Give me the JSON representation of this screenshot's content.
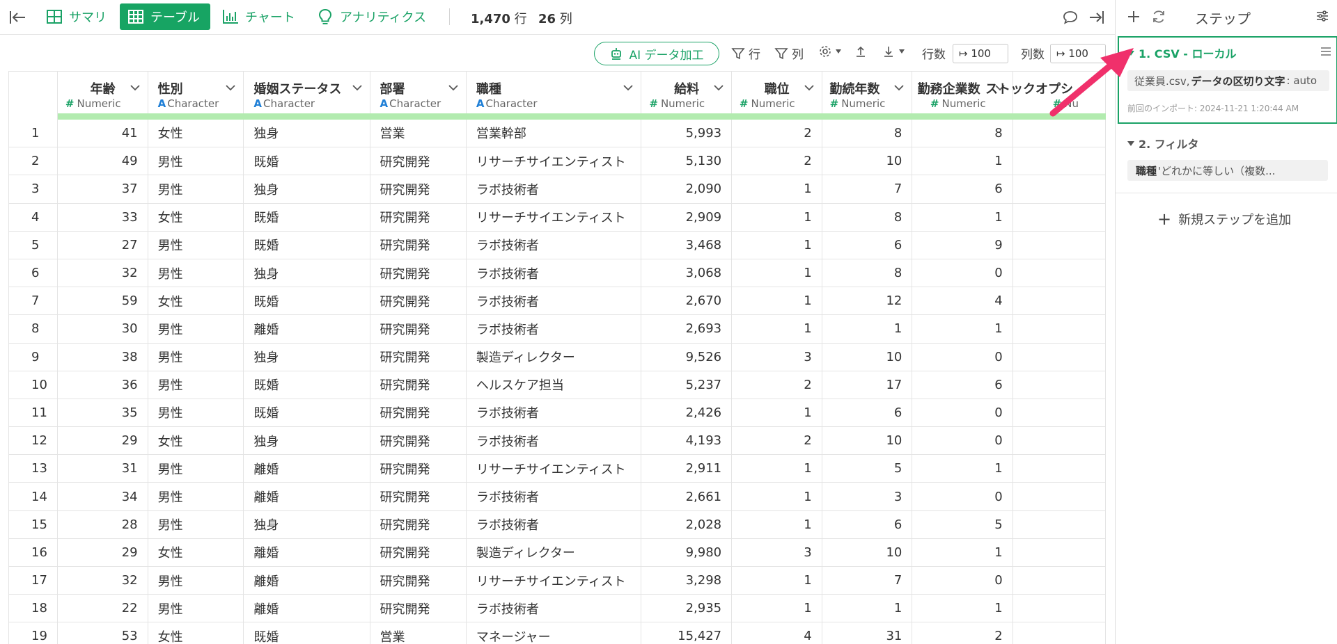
{
  "topbar": {
    "views": [
      {
        "label": "サマリ",
        "icon": "summary-grid-icon"
      },
      {
        "label": "テーブル",
        "icon": "table-icon"
      },
      {
        "label": "チャート",
        "icon": "bar-chart-icon"
      },
      {
        "label": "アナリティクス",
        "icon": "lightbulb-icon"
      }
    ],
    "rows_count": "1,470",
    "rows_unit": "行",
    "cols_count": "26",
    "cols_unit": "列"
  },
  "toolbar": {
    "ai_label": "AI データ加工",
    "filter_rows": "行",
    "filter_cols": "列",
    "rows_label": "行数",
    "rows_value": "↦ 100",
    "cols_label": "列数",
    "cols_value": "↦ 100"
  },
  "columns": [
    {
      "name": "年齢",
      "type": "Numeric",
      "kind": "num"
    },
    {
      "name": "性別",
      "type": "Character",
      "kind": "chr"
    },
    {
      "name": "婚姻ステータス",
      "type": "Character",
      "kind": "chr"
    },
    {
      "name": "部署",
      "type": "Character",
      "kind": "chr"
    },
    {
      "name": "職種",
      "type": "Character",
      "kind": "chr"
    },
    {
      "name": "給料",
      "type": "Numeric",
      "kind": "num"
    },
    {
      "name": "職位",
      "type": "Numeric",
      "kind": "num"
    },
    {
      "name": "勤続年数",
      "type": "Numeric",
      "kind": "num"
    },
    {
      "name": "勤務企業数",
      "type": "Numeric",
      "kind": "num"
    },
    {
      "name": "ストックオプシ",
      "type": "Nu",
      "kind": "num"
    }
  ],
  "rows": [
    [
      "1",
      "41",
      "女性",
      "独身",
      "営業",
      "営業幹部",
      "5,993",
      "2",
      "8",
      "8",
      ""
    ],
    [
      "2",
      "49",
      "男性",
      "既婚",
      "研究開発",
      "リサーチサイエンティスト",
      "5,130",
      "2",
      "10",
      "1",
      ""
    ],
    [
      "3",
      "37",
      "男性",
      "独身",
      "研究開発",
      "ラボ技術者",
      "2,090",
      "1",
      "7",
      "6",
      ""
    ],
    [
      "4",
      "33",
      "女性",
      "既婚",
      "研究開発",
      "リサーチサイエンティスト",
      "2,909",
      "1",
      "8",
      "1",
      ""
    ],
    [
      "5",
      "27",
      "男性",
      "既婚",
      "研究開発",
      "ラボ技術者",
      "3,468",
      "1",
      "6",
      "9",
      ""
    ],
    [
      "6",
      "32",
      "男性",
      "独身",
      "研究開発",
      "ラボ技術者",
      "3,068",
      "1",
      "8",
      "0",
      ""
    ],
    [
      "7",
      "59",
      "女性",
      "既婚",
      "研究開発",
      "ラボ技術者",
      "2,670",
      "1",
      "12",
      "4",
      ""
    ],
    [
      "8",
      "30",
      "男性",
      "離婚",
      "研究開発",
      "ラボ技術者",
      "2,693",
      "1",
      "1",
      "1",
      ""
    ],
    [
      "9",
      "38",
      "男性",
      "独身",
      "研究開発",
      "製造ディレクター",
      "9,526",
      "3",
      "10",
      "0",
      ""
    ],
    [
      "10",
      "36",
      "男性",
      "既婚",
      "研究開発",
      "ヘルスケア担当",
      "5,237",
      "2",
      "17",
      "6",
      ""
    ],
    [
      "11",
      "35",
      "男性",
      "既婚",
      "研究開発",
      "ラボ技術者",
      "2,426",
      "1",
      "6",
      "0",
      ""
    ],
    [
      "12",
      "29",
      "女性",
      "独身",
      "研究開発",
      "ラボ技術者",
      "4,193",
      "2",
      "10",
      "0",
      ""
    ],
    [
      "13",
      "31",
      "男性",
      "離婚",
      "研究開発",
      "リサーチサイエンティスト",
      "2,911",
      "1",
      "5",
      "1",
      ""
    ],
    [
      "14",
      "34",
      "男性",
      "離婚",
      "研究開発",
      "ラボ技術者",
      "2,661",
      "1",
      "3",
      "0",
      ""
    ],
    [
      "15",
      "28",
      "男性",
      "独身",
      "研究開発",
      "ラボ技術者",
      "2,028",
      "1",
      "6",
      "5",
      ""
    ],
    [
      "16",
      "29",
      "女性",
      "離婚",
      "研究開発",
      "製造ディレクター",
      "9,980",
      "3",
      "10",
      "1",
      ""
    ],
    [
      "17",
      "32",
      "男性",
      "離婚",
      "研究開発",
      "リサーチサイエンティスト",
      "3,298",
      "1",
      "7",
      "0",
      ""
    ],
    [
      "18",
      "22",
      "男性",
      "離婚",
      "研究開発",
      "ラボ技術者",
      "2,935",
      "1",
      "1",
      "1",
      ""
    ],
    [
      "19",
      "53",
      "女性",
      "既婚",
      "営業",
      "マネージャー",
      "15,427",
      "4",
      "31",
      "2",
      ""
    ]
  ],
  "steps_panel": {
    "title": "ステップ",
    "step1": {
      "title": "1. CSV - ローカル",
      "chip_prefix": "従業員.csv,",
      "chip_bold": "データの区切り文字",
      "chip_suffix": ": auto",
      "import_info": "前回のインポート: 2024-11-21 1:20:44 AM"
    },
    "step2": {
      "title": "2. フィルタ",
      "chip_bold": "職種",
      "chip_suffix": "'どれかに等しい（複数..."
    },
    "add_step": "新規ステップを追加"
  },
  "colors": {
    "accent": "#17a463",
    "numeric_hash": "#1aa266",
    "character_a": "#1f7fd6",
    "header_bar": "#b2ebaf",
    "annotation_arrow": "#f0306b"
  }
}
